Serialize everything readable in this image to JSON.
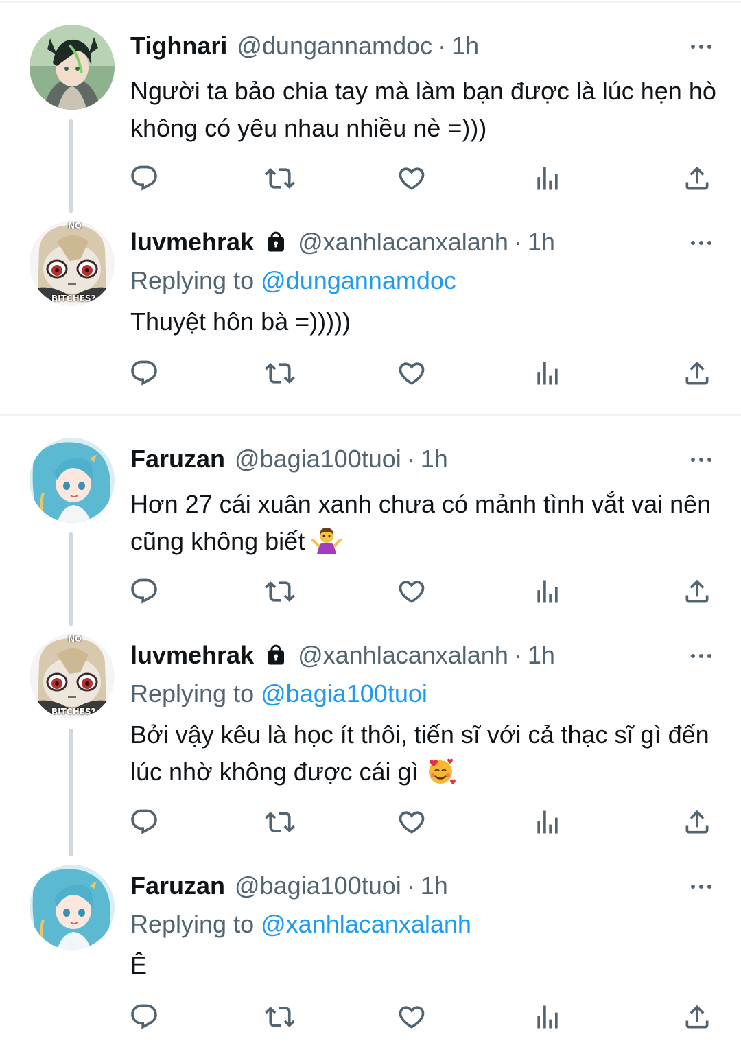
{
  "tweets": [
    {
      "name": "Tighnari",
      "handle": "@dungannamdoc",
      "dot": "·",
      "time": "1h",
      "replying_prefix": "",
      "replying_to": "",
      "text": "Người ta bảo chia tay mà làm bạn được là lúc hẹn hò không có yêu nhau nhiều nè =)))",
      "protected": false,
      "avatar": "tighnari-avatar"
    },
    {
      "name": "luvmehrak",
      "handle": "@xanhlacanxalanh",
      "dot": "·",
      "time": "1h",
      "replying_prefix": "Replying to",
      "replying_to": "@dungannamdoc",
      "text": "Thuyệt hôn bà =)))))",
      "protected": true,
      "avatar": "luvmehrak-avatar",
      "avatar_text_top": "NO",
      "avatar_text_bottom": "BITCHES?"
    },
    {
      "name": "Faruzan",
      "handle": "@bagia100tuoi",
      "dot": "·",
      "time": "1h",
      "replying_prefix": "",
      "replying_to": "",
      "text": "Hơn 27 cái xuân xanh chưa có mảnh tình vắt vai nên cũng không biết",
      "emoji": "woman-shrugging",
      "protected": false,
      "avatar": "faruzan-avatar"
    },
    {
      "name": "luvmehrak",
      "handle": "@xanhlacanxalanh",
      "dot": "·",
      "time": "1h",
      "replying_prefix": "Replying to",
      "replying_to": "@bagia100tuoi",
      "text": "Bởi vậy kêu là học ít thôi, tiến sĩ với cả thạc sĩ gì đến lúc nhờ không được cái gì",
      "emoji": "smiling-face-with-hearts",
      "protected": true,
      "avatar": "luvmehrak-avatar",
      "avatar_text_top": "NO",
      "avatar_text_bottom": "BITCHES?"
    },
    {
      "name": "Faruzan",
      "handle": "@bagia100tuoi",
      "dot": "·",
      "time": "1h",
      "replying_prefix": "Replying to",
      "replying_to": "@xanhlacanxalanh",
      "text": "Ê",
      "protected": false,
      "avatar": "faruzan-avatar"
    }
  ],
  "colors": {
    "text": "#0f1419",
    "secondary": "#536471",
    "link": "#1d9bf0",
    "thread_line": "#cfd9de",
    "divider": "#eff3f4"
  },
  "icons": [
    "reply-icon",
    "retweet-icon",
    "like-icon",
    "views-icon",
    "share-icon",
    "more-icon",
    "lock-icon"
  ]
}
